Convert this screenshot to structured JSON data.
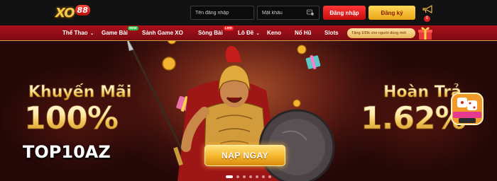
{
  "header": {
    "logo_text": "XO",
    "logo_number": "88",
    "username_placeholder": "Tên đăng nhập",
    "password_placeholder": "Mật khẩu",
    "login_label": "Đăng nhập",
    "register_label": "Đăng ký",
    "notification_count": "0"
  },
  "nav": {
    "items": [
      {
        "label": "Thể Thao"
      },
      {
        "label": "Game Bài"
      },
      {
        "label": "Sảnh Game XO"
      },
      {
        "label": "Sòng Bài"
      },
      {
        "label": "Lô Đề"
      },
      {
        "label": "Keno"
      },
      {
        "label": "Nổ Hũ"
      },
      {
        "label": "Slots"
      }
    ],
    "new_tag": "NEW",
    "live_tag": "LIVE",
    "promo_text": "Tặng 100k cho người dùng mới"
  },
  "hero": {
    "left_title": "Khuyến Mãi",
    "left_value": "100%",
    "code": "TOP10AZ",
    "right_title": "Hoàn Trả",
    "right_value": "1.62%",
    "cta_label": "NẠP NGAY",
    "slide_count": 7,
    "active_slide": 1
  },
  "colors": {
    "nav_red": "#a9101a",
    "login_red": "#e02020",
    "register_gold": "#f5b52a",
    "gold_text": "#f1c457"
  }
}
